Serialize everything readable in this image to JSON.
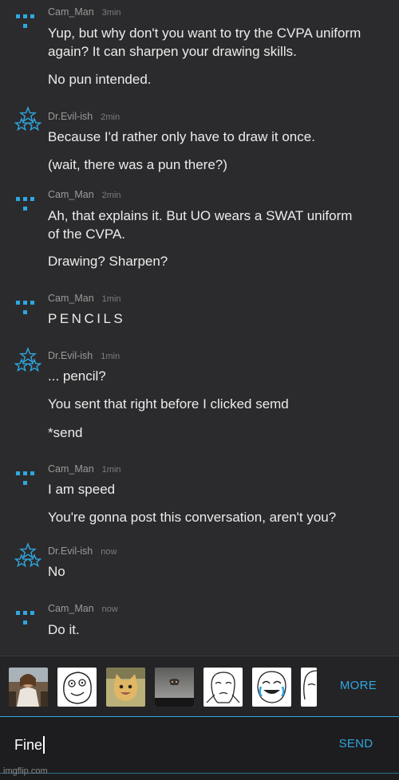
{
  "accent_color": "#2fa7df",
  "users": {
    "cam": {
      "name": "Cam_Man",
      "avatar_icon": "blue-dots-avatar-icon"
    },
    "evil": {
      "name": "Dr.Evil-ish",
      "avatar_icon": "star-pyramid-avatar-icon"
    }
  },
  "messages": [
    {
      "user": "cam",
      "name": "Cam_Man",
      "time": "3min",
      "lines": [
        "Yup, but why don't you want to try the CVPA uniform",
        "again? It can sharpen your drawing skills.",
        "No pun intended."
      ]
    },
    {
      "user": "evil",
      "name": "Dr.Evil-ish",
      "time": "2min",
      "lines": [
        "Because I'd rather only have to draw it once.",
        "(wait, there was a pun there?)"
      ]
    },
    {
      "user": "cam",
      "name": "Cam_Man",
      "time": "2min",
      "lines": [
        "Ah, that explains it. But UO wears a SWAT uniform",
        "of the CVPA.",
        "Drawing? Sharpen?"
      ]
    },
    {
      "user": "cam",
      "name": "Cam_Man",
      "time": "1min",
      "lines": [
        "PENCILS"
      ]
    },
    {
      "user": "evil",
      "name": "Dr.Evil-ish",
      "time": "1min",
      "lines": [
        "... pencil?",
        "You sent that right before I clicked semd",
        "*send"
      ]
    },
    {
      "user": "cam",
      "name": "Cam_Man",
      "time": "1min",
      "lines": [
        "I am speed",
        "You're gonna post this conversation, aren't you?"
      ]
    },
    {
      "user": "evil",
      "name": "Dr.Evil-ish",
      "time": "now",
      "lines": [
        "No"
      ]
    },
    {
      "user": "cam",
      "name": "Cam_Man",
      "time": "now",
      "lines": [
        "Do it."
      ]
    }
  ],
  "emoji_bar": {
    "thumbnails": [
      "jesus-meme-thumbnail",
      "rage-face-thumbnail",
      "happy-cat-thumbnail",
      "ceiling-cat-thumbnail",
      "okay-face-thumbnail",
      "tears-of-joy-face-thumbnail",
      "challenge-accepted-face-thumbnail"
    ],
    "more_label": "MORE"
  },
  "composer": {
    "input_value": "Fine",
    "send_label": "SEND"
  },
  "watermark": "imgflip.com"
}
